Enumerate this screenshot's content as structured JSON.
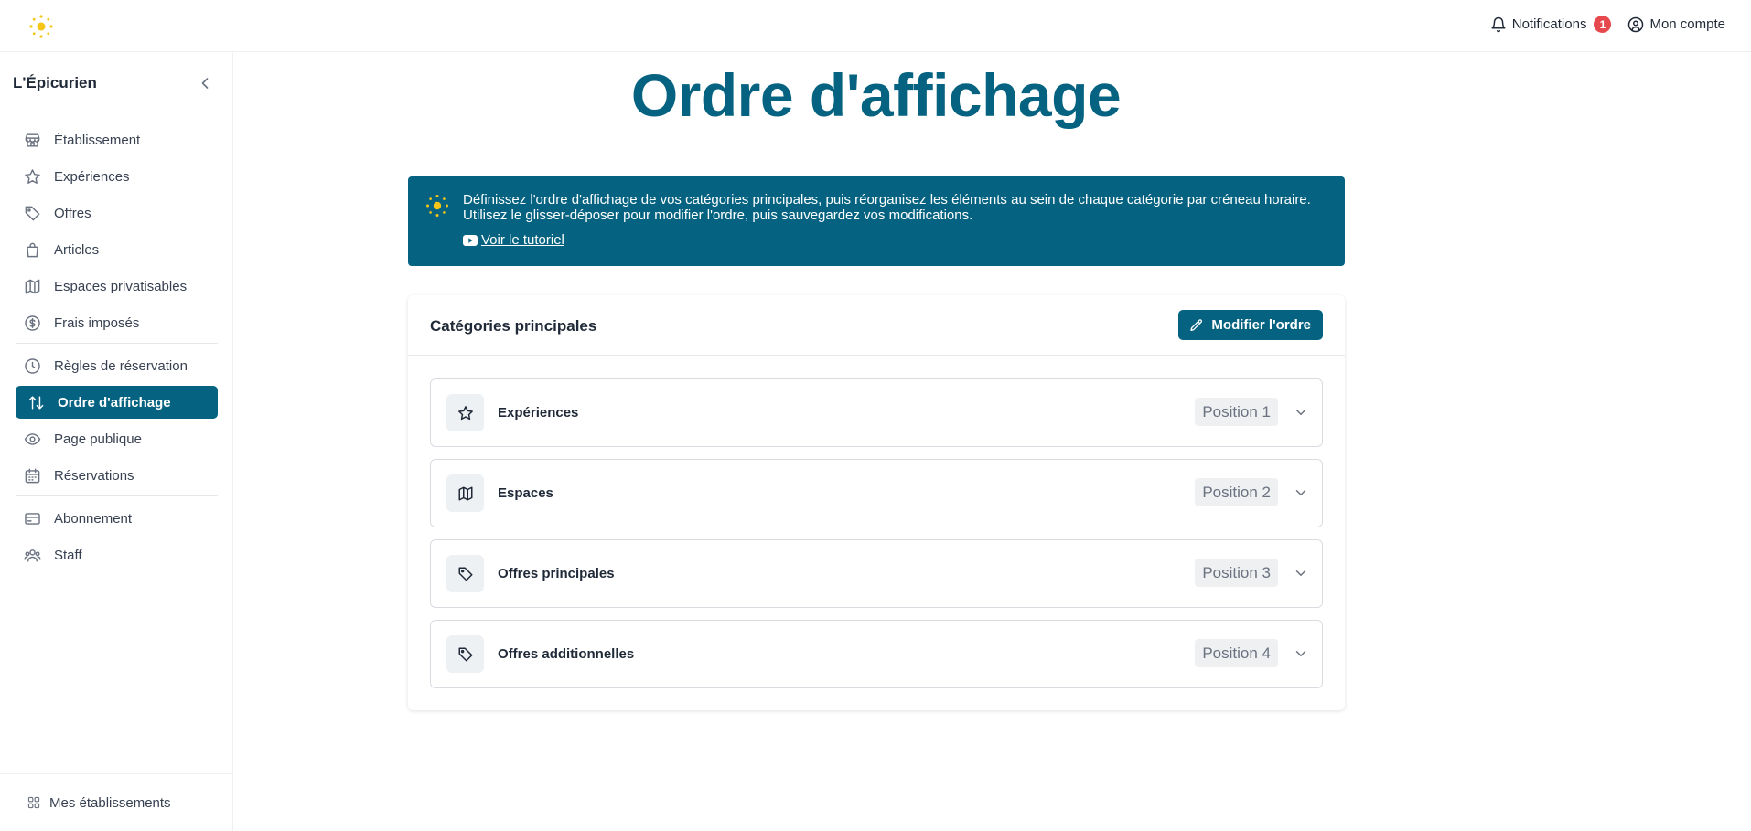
{
  "colors": {
    "primary": "#056381",
    "badge": "#e5484d",
    "logo": "#f5c518"
  },
  "topbar": {
    "logo_icon": "sun-icon",
    "notifications_label": "Notifications",
    "notifications_count": "1",
    "account_label": "Mon compte"
  },
  "sidebar": {
    "brand": "L'Épicurien",
    "items": [
      {
        "label": "Établissement",
        "icon": "store-icon"
      },
      {
        "label": "Expériences",
        "icon": "star-icon"
      },
      {
        "label": "Offres",
        "icon": "tag-icon"
      },
      {
        "label": "Articles",
        "icon": "shopping-bag-icon"
      },
      {
        "label": "Espaces privatisables",
        "icon": "map-icon"
      },
      {
        "label": "Frais imposés",
        "icon": "dollar-circle-icon"
      },
      {
        "label": "Règles de réservation",
        "icon": "clock-icon"
      },
      {
        "label": "Ordre d'affichage",
        "icon": "arrows-up-down-icon",
        "active": true
      },
      {
        "label": "Page publique",
        "icon": "eye-icon"
      },
      {
        "label": "Réservations",
        "icon": "calendar-icon"
      },
      {
        "label": "Abonnement",
        "icon": "credit-card-icon"
      },
      {
        "label": "Staff",
        "icon": "users-icon"
      }
    ],
    "footer_label": "Mes établissements"
  },
  "main": {
    "title": "Ordre d'affichage",
    "banner": {
      "line1": "Définissez l'ordre d'affichage de vos catégories principales, puis réorganisez les éléments au sein de chaque catégorie par créneau horaire.",
      "line2": "Utilisez le glisser-déposer pour modifier l'ordre, puis sauvegardez vos modifications.",
      "tutorial_label": "Voir le tutoriel"
    },
    "card": {
      "title": "Catégories principales",
      "edit_label": "Modifier l'ordre",
      "rows": [
        {
          "label": "Expériences",
          "position": "Position 1",
          "icon": "star-icon"
        },
        {
          "label": "Espaces",
          "position": "Position 2",
          "icon": "map-icon"
        },
        {
          "label": "Offres principales",
          "position": "Position 3",
          "icon": "tag-icon"
        },
        {
          "label": "Offres additionnelles",
          "position": "Position 4",
          "icon": "tag-icon"
        }
      ]
    }
  }
}
